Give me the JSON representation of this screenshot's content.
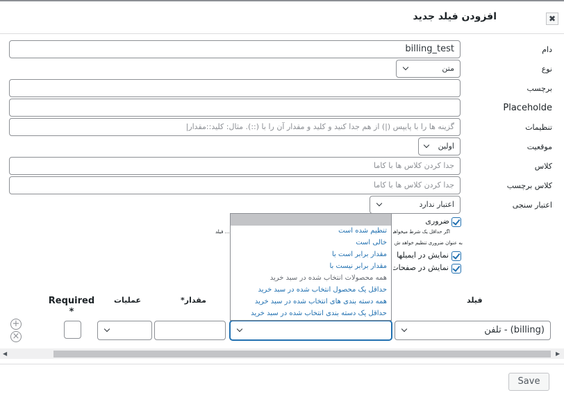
{
  "dialog": {
    "title": "افزودن فیلد جدید",
    "close": "✖"
  },
  "form": {
    "name_label": "دام",
    "name_value": "billing_test",
    "type_label": "نوع",
    "type_value": "متن",
    "label_label": "برچسب",
    "placeholder_label": "Placeholde",
    "settings_label": "تنظیمات",
    "settings_placeholder": "گزینه ها را با پایپس (|) از هم جدا کنید و کلید  و مقدار آن را با (::). مثال: کلید::مقدار|",
    "position_label": "موقعیت",
    "position_value": "اولین",
    "class_label": "کلاس",
    "class_placeholder": "جدا کردن کلاس ها با کاما",
    "label_class_label": "کلاس برچسب",
    "label_class_placeholder": "جدا کردن کلاس ها با کاما",
    "validation_label": "اعتبار سنجی",
    "validation_value": "اعتبار ندارد",
    "required_label": "ضروری",
    "required_note_1": "اگر حداقل یک شرط میخواهید تن",
    "required_note_1_tail": "... فیلد",
    "required_note_2": "به عنوان ضروری تنظیم خواهد ش",
    "show_emails_label": "نمایش در ایمیلها",
    "show_pages_label": "نمایش در صفحات"
  },
  "operator_dropdown": {
    "options": [
      "تنظیم شده است",
      "خالی است",
      "مقدار برابر است با",
      "مقدار برابر نیست با",
      "همه محصولات انتخاب شده در سبد خرید",
      "حداقل یک محصول انتخاب شده در سبد خرید",
      "همه دسته بندی های انتخاب شده در سبد خرید",
      "حداقل یک دسته بندی انتخاب شده در سبد خرید"
    ]
  },
  "conditions": {
    "col_field": "فیلد",
    "col_value": "مقدار*",
    "col_operations": "عملیات",
    "col_required": "Required *",
    "field_value": "(billing) - تلفن",
    "add_symbol": "+",
    "remove_symbol": "×"
  },
  "scrollbar": {
    "left_arrow": "◀",
    "right_arrow": "▶"
  },
  "footer": {
    "save_label": "Save"
  },
  "colors": {
    "accent": "#2271b1",
    "border": "#8c8f94",
    "dropdown_header": "#c3c4c7"
  }
}
